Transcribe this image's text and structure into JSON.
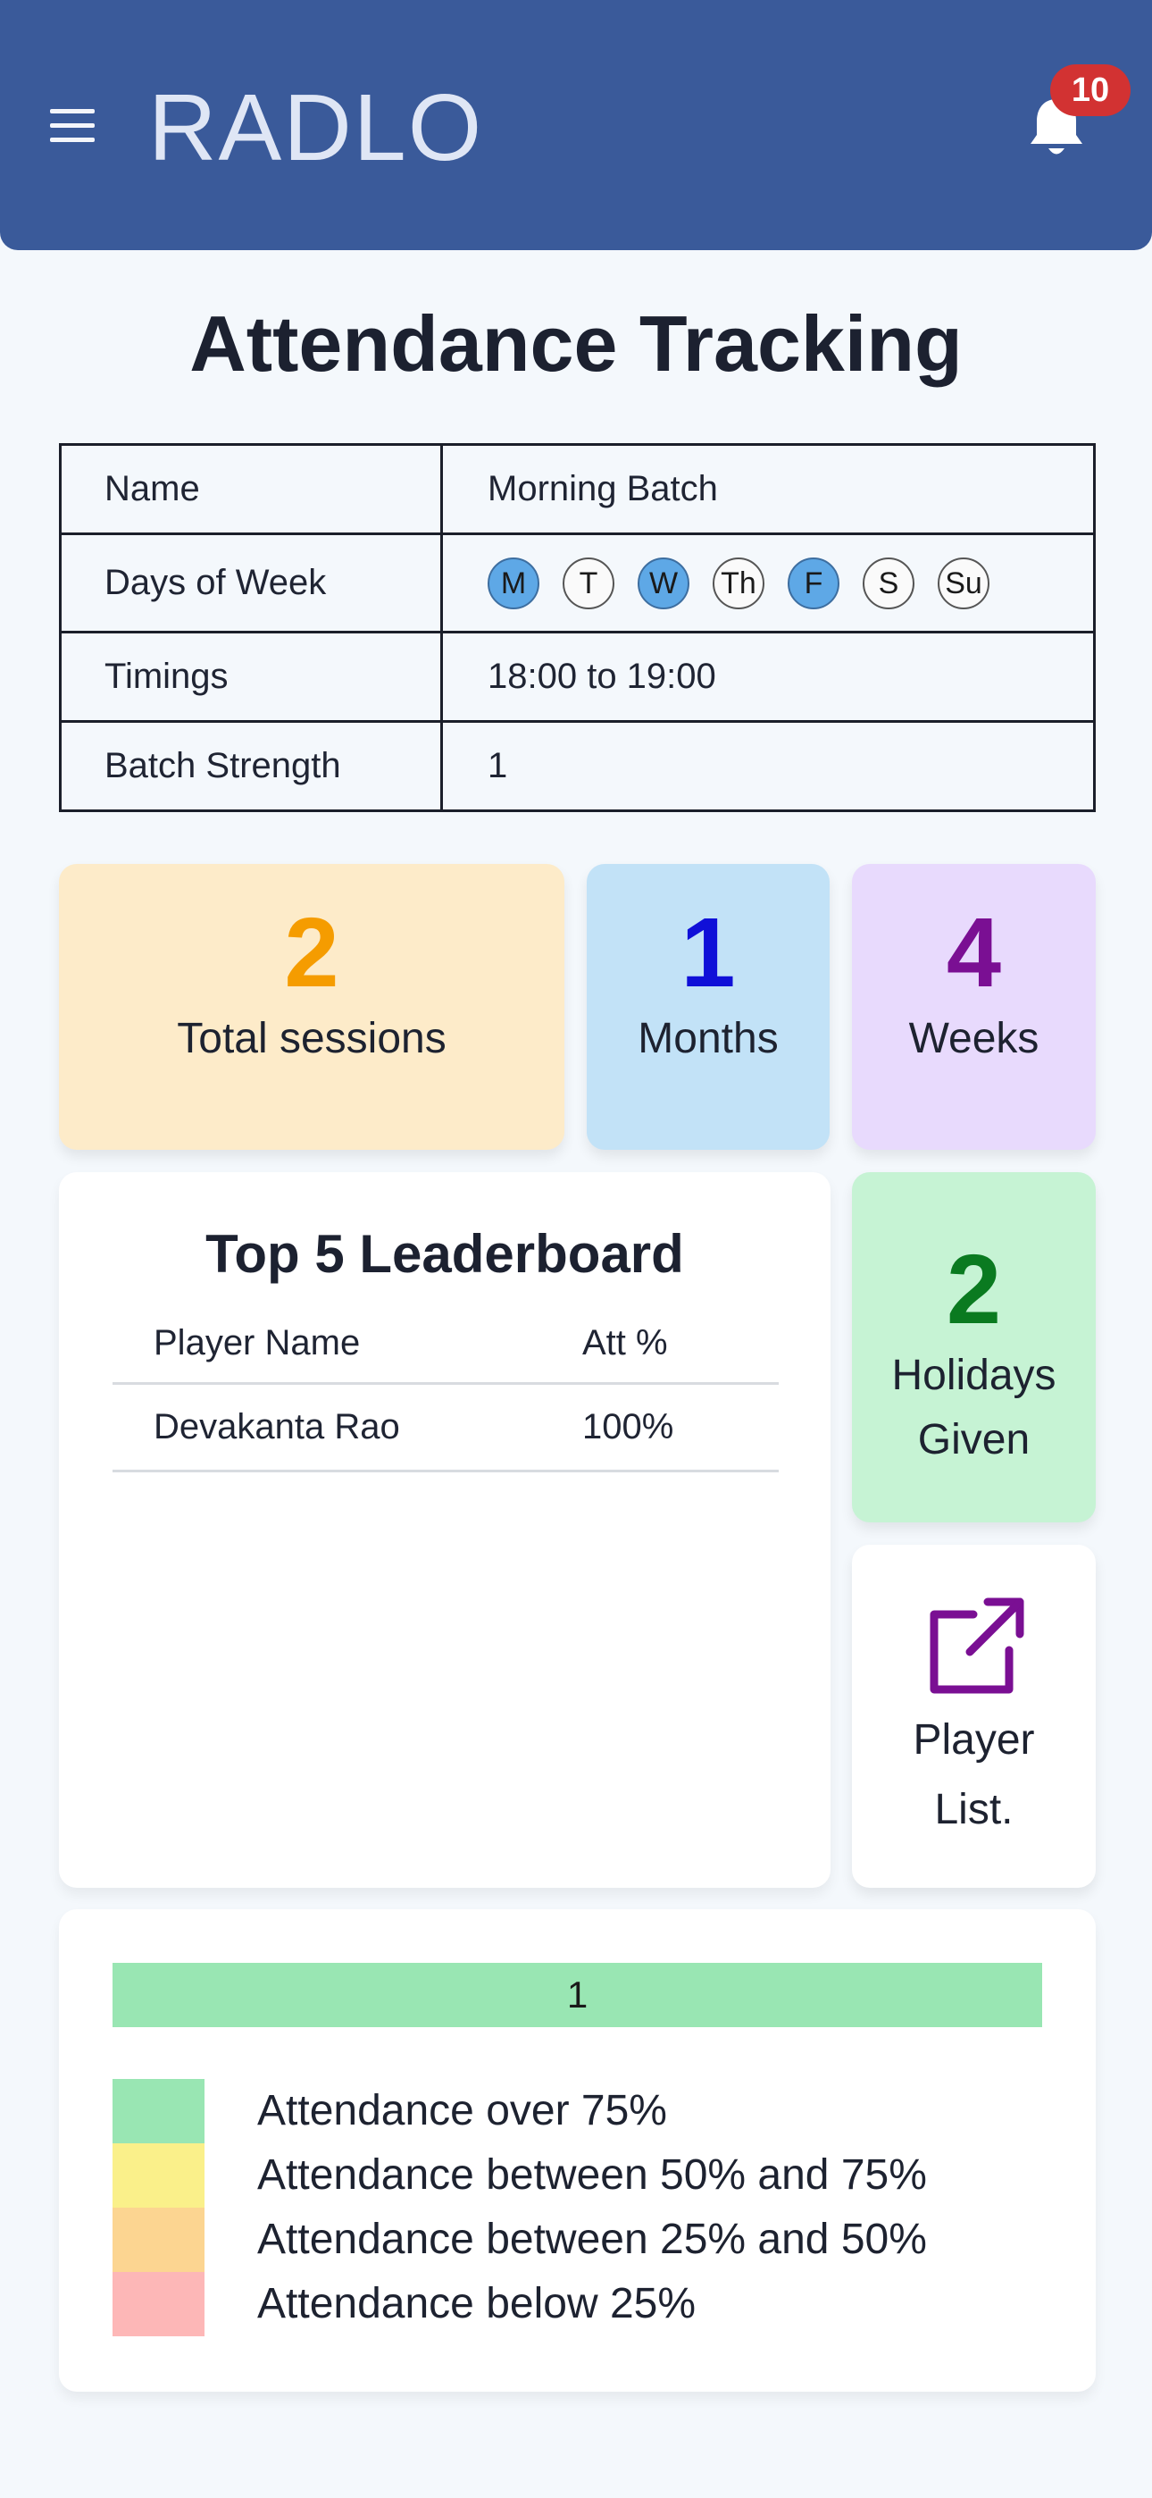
{
  "app": {
    "brand": "RADLO",
    "notification_count": "10"
  },
  "page": {
    "title": "Attendance Tracking"
  },
  "batch": {
    "rows": [
      {
        "label": "Name",
        "value": "Morning Batch"
      },
      {
        "label": "Days of Week",
        "value": ""
      },
      {
        "label": "Timings",
        "value": "18:00 to 19:00"
      },
      {
        "label": "Batch Strength",
        "value": "1"
      }
    ],
    "days": [
      {
        "label": "M",
        "selected": true
      },
      {
        "label": "T",
        "selected": false
      },
      {
        "label": "W",
        "selected": true
      },
      {
        "label": "Th",
        "selected": false
      },
      {
        "label": "F",
        "selected": true
      },
      {
        "label": "S",
        "selected": false
      },
      {
        "label": "Su",
        "selected": false
      }
    ]
  },
  "stats": {
    "total_sessions": {
      "value": "2",
      "label": "Total sessions"
    },
    "months": {
      "value": "1",
      "label": "Months"
    },
    "weeks": {
      "value": "4",
      "label": "Weeks"
    },
    "holidays": {
      "value": "2",
      "label_line1": "Holidays",
      "label_line2": "Given"
    },
    "player_list": {
      "label_line1": "Player",
      "label_line2": "List."
    }
  },
  "leaderboard": {
    "title": "Top 5 Leaderboard",
    "headers": [
      "Player Name",
      "Att %"
    ],
    "rows": [
      {
        "name": "Devakanta Rao",
        "att": "100%"
      }
    ]
  },
  "distribution": {
    "bar_label": "1",
    "bar_fraction": 1.0,
    "legend": [
      {
        "label": "Attendance over 75%",
        "color": "#99e6b3"
      },
      {
        "label": "Attendance between 50% and 75%",
        "color": "#faf08a"
      },
      {
        "label": "Attendance between 25% and 50%",
        "color": "#fcd591"
      },
      {
        "label": "Attendance below 25%",
        "color": "#fdb7b7"
      }
    ]
  },
  "icons": {
    "menu": "menu-icon",
    "bell": "bell-icon",
    "external_link": "external-link-icon"
  },
  "colors": {
    "header_bg": "#3a5a9a",
    "badge": "#d23232",
    "day_selected": "#5ea8e6"
  }
}
